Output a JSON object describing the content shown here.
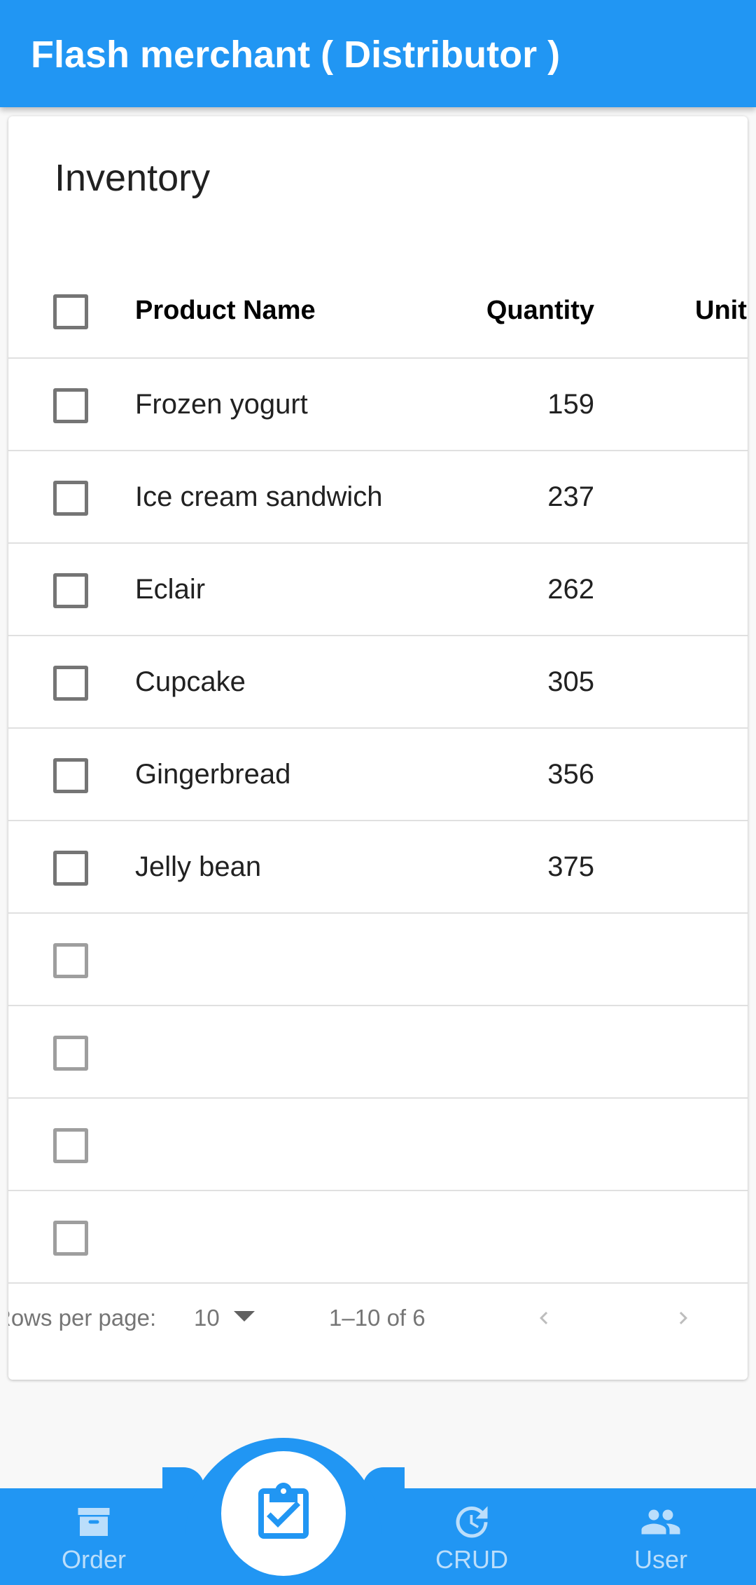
{
  "app": {
    "title": "Flash merchant ( Distributor )"
  },
  "card": {
    "title": "Inventory"
  },
  "table": {
    "headers": {
      "name": "Product Name",
      "quantity": "Quantity",
      "unit": "Unit"
    },
    "rows": [
      {
        "name": "Frozen yogurt",
        "quantity": "159"
      },
      {
        "name": "Ice cream sandwich",
        "quantity": "237"
      },
      {
        "name": "Eclair",
        "quantity": "262"
      },
      {
        "name": "Cupcake",
        "quantity": "305"
      },
      {
        "name": "Gingerbread",
        "quantity": "356"
      },
      {
        "name": "Jelly bean",
        "quantity": "375"
      }
    ]
  },
  "pagination": {
    "rows_per_page_label": "Rows per page:",
    "rows_per_page_value": "10",
    "range": "1–10 of 6"
  },
  "bottom_nav": {
    "items": [
      {
        "label": "Order",
        "icon": "archive-icon"
      },
      {
        "label": "",
        "icon": "clipboard-check-icon"
      },
      {
        "label": "CRUD",
        "icon": "update-clock-icon"
      },
      {
        "label": "User",
        "icon": "people-icon"
      }
    ]
  },
  "colors": {
    "primary": "#2196f3",
    "nav_label": "#bbdefb",
    "background": "#f8f8f8"
  }
}
